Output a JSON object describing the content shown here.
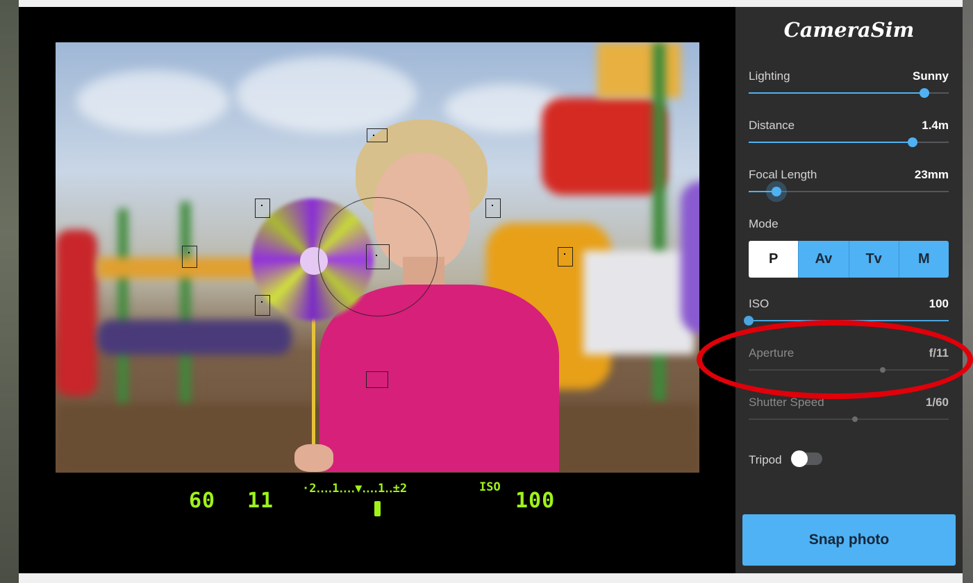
{
  "app": {
    "logo": "CameraSim"
  },
  "viewfinder": {
    "readout": {
      "shutter": "60",
      "aperture": "11",
      "meter_scale": "·2‥‥1‥‥▼‥‥1‥±2",
      "iso_label": "ISO",
      "iso": "100"
    }
  },
  "controls": {
    "lighting": {
      "label": "Lighting",
      "value": "Sunny",
      "level": 0.88
    },
    "distance": {
      "label": "Distance",
      "value": "1.4m",
      "level": 0.82
    },
    "focal_length": {
      "label": "Focal Length",
      "value": "23mm",
      "level": 0.14
    },
    "mode": {
      "label": "Mode",
      "options": [
        "P",
        "Av",
        "Tv",
        "M"
      ],
      "selected": "P"
    },
    "iso": {
      "label": "ISO",
      "value": "100",
      "level": 0.0
    },
    "aperture": {
      "label": "Aperture",
      "value": "f/11",
      "level": 0.67
    },
    "shutter_speed": {
      "label": "Shutter Speed",
      "value": "1/60",
      "level": 0.53
    },
    "tripod": {
      "label": "Tripod",
      "on": false
    }
  },
  "snap_button": {
    "label": "Snap photo"
  },
  "colors": {
    "accent": "#4fb2f4",
    "lcd": "#9ff21a",
    "annotation": "#e0000a",
    "panel": "#2d2d2d"
  }
}
